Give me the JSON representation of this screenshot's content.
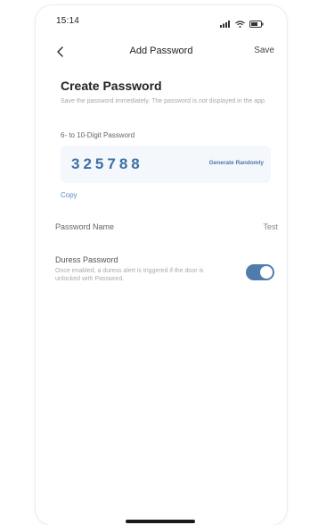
{
  "status_bar": {
    "time": "15:14"
  },
  "nav": {
    "title": "Add Password",
    "save_label": "Save"
  },
  "create_password": {
    "title": "Create Password",
    "description": "Save the password immediately. The password is not displayed in the app.",
    "digit_label": "6- to 10-Digit Password",
    "password_value": "325788",
    "generate_label": "Generate Randomly",
    "copy_label": "Copy"
  },
  "password_name": {
    "label": "Password Name",
    "value": "Test"
  },
  "duress": {
    "title": "Duress Password",
    "description": "Once enabled, a duress alert is triggered if the door is unlocked with Password.",
    "enabled": true
  },
  "colors": {
    "accent": "#4f7cad",
    "password_text": "#3d6fa6",
    "card_background": "#f4f7fb"
  }
}
